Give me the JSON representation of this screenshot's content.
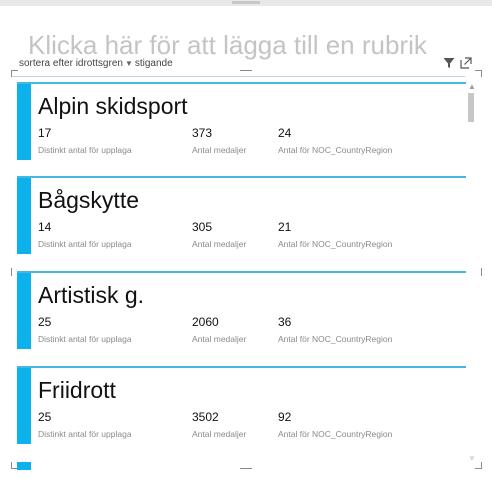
{
  "visual": {
    "title_placeholder": "Klicka här för att lägga till en rubrik",
    "sort_label": "sortera efter idrottsgren",
    "sort_direction": "stigande",
    "accent_color": "#0db2ec",
    "icons": {
      "filter": "filter-icon",
      "focus_mode": "focus-mode-icon",
      "dropdown": "chevron-down-icon"
    }
  },
  "cards": [
    {
      "name": "Alpin skidsport",
      "distinct_count": "17",
      "medals": "373",
      "countries": "24"
    },
    {
      "name": "Bågskytte",
      "distinct_count": "14",
      "medals": "305",
      "countries": "21"
    },
    {
      "name": "Artistisk g.",
      "distinct_count": "25",
      "medals": "2060",
      "countries": "36"
    },
    {
      "name": "Friidrott",
      "distinct_count": "25",
      "medals": "3502",
      "countries": "92"
    }
  ],
  "labels": {
    "distinct_count": "Distinkt antal för upplaga",
    "medals": "Antal medaljer",
    "countries": "Antal för NOC_CountryRegion"
  }
}
